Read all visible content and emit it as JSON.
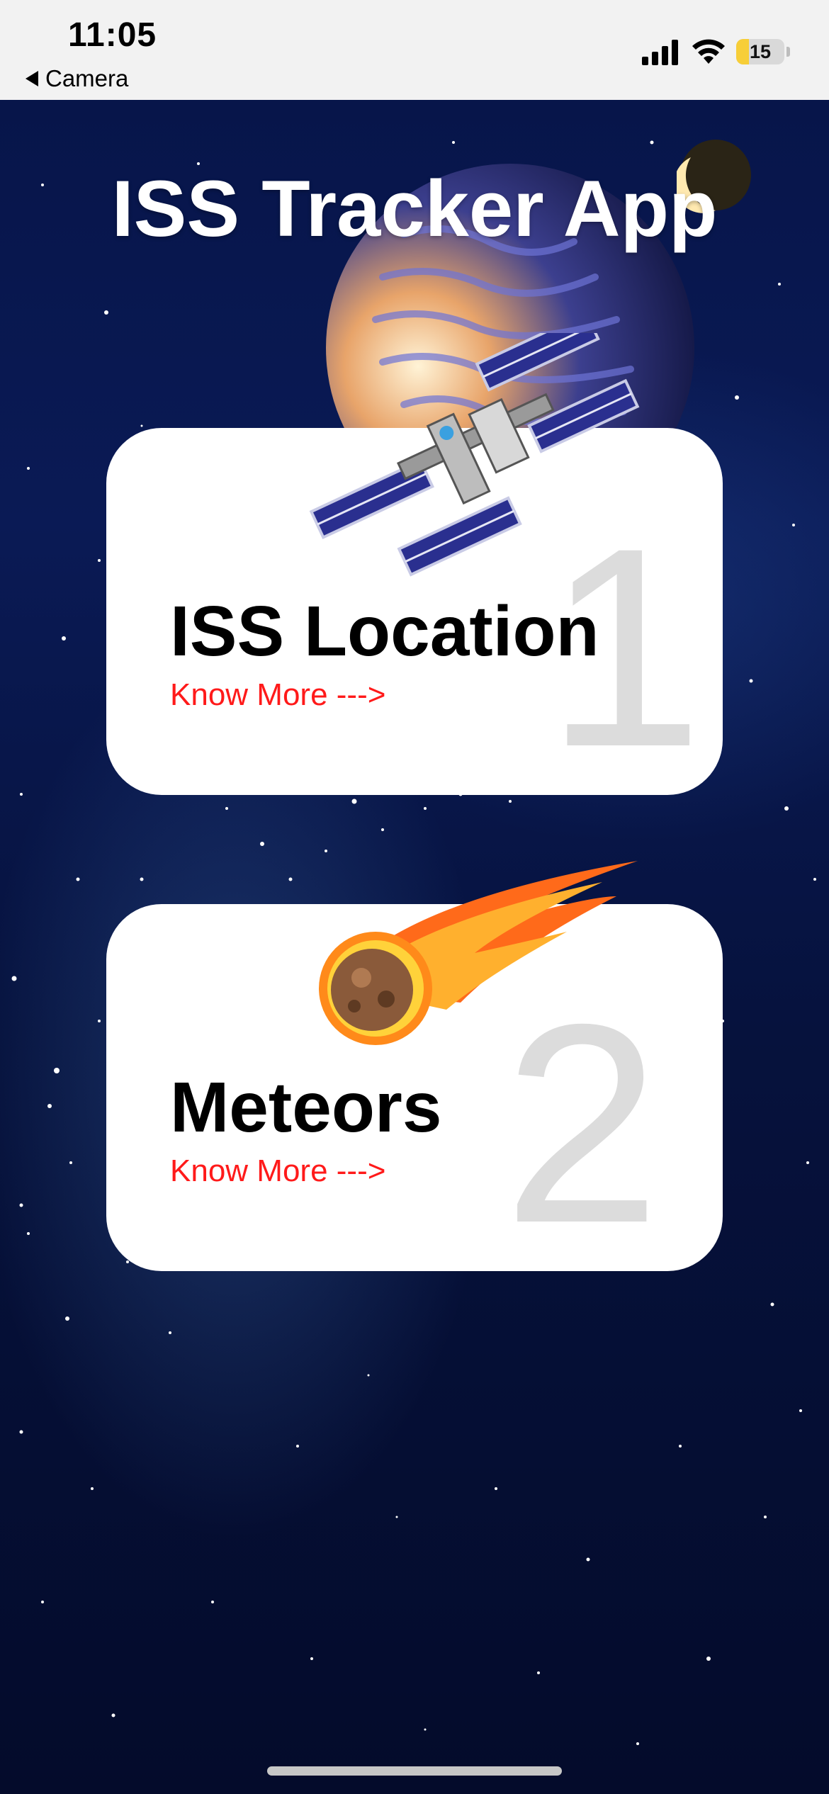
{
  "status_bar": {
    "time": "11:05",
    "back_label": "Camera",
    "battery_level": "15"
  },
  "app": {
    "title": "ISS Tracker App"
  },
  "cards": [
    {
      "title": "ISS Location",
      "link": "Know More --->",
      "number": "1",
      "icon": "iss-station-icon"
    },
    {
      "title": "Meteors",
      "link": "Know More --->",
      "number": "2",
      "icon": "meteor-icon"
    }
  ],
  "colors": {
    "link": "#ff1a1a",
    "background": "#07154a",
    "card": "#ffffff",
    "number": "#dcdcdc"
  }
}
